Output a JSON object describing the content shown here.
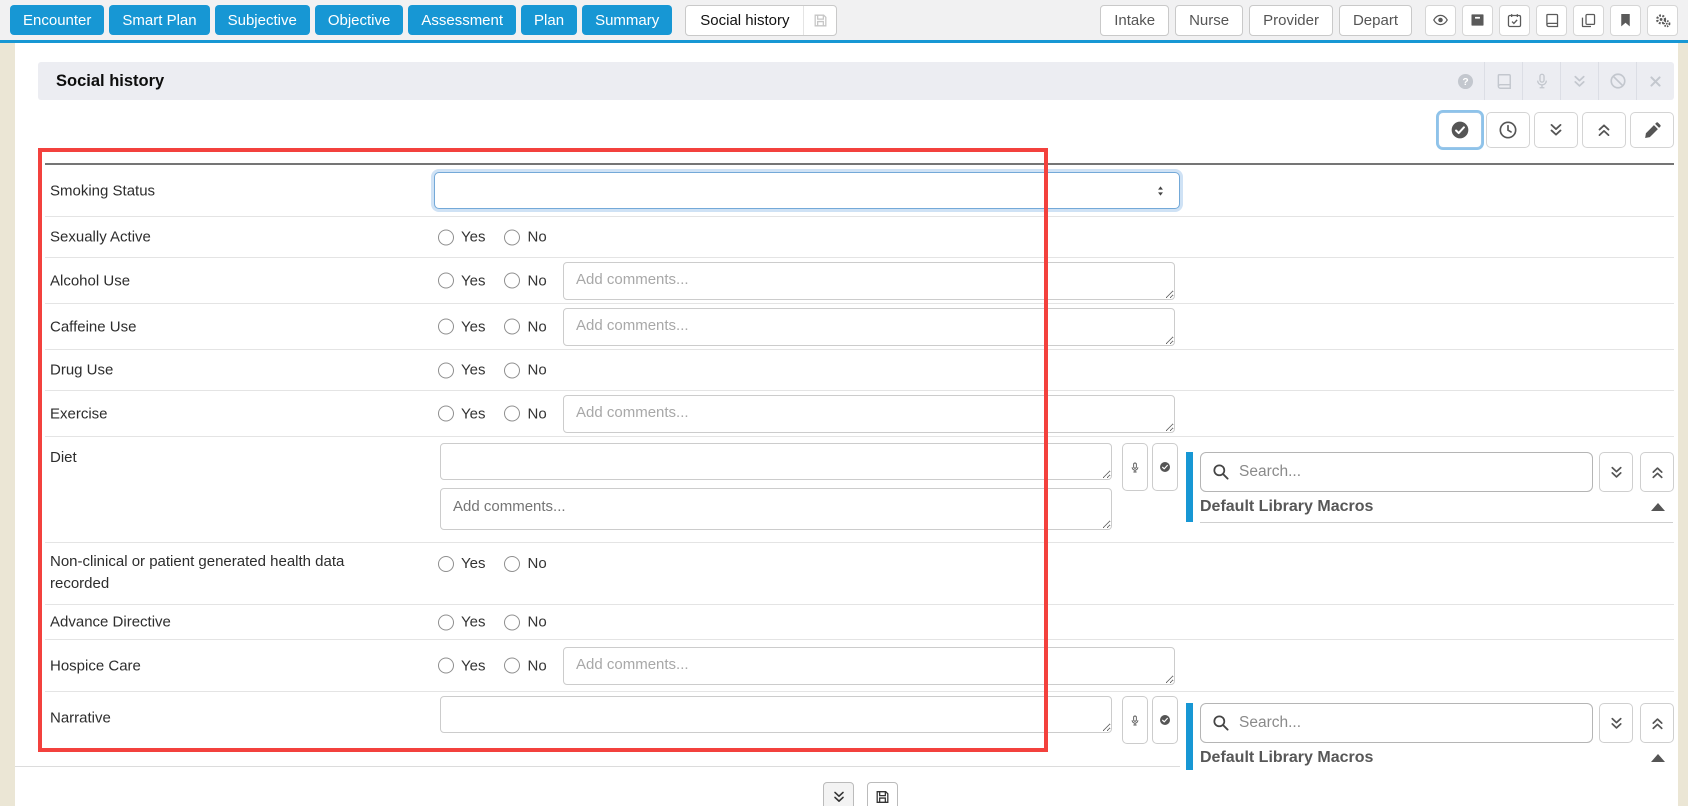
{
  "colors": {
    "accent_blue": "#1797d4",
    "annotation_red": "#f3413d"
  },
  "topbar": {
    "nav_buttons": [
      "Encounter",
      "Smart Plan",
      "Subjective",
      "Objective",
      "Assessment",
      "Plan",
      "Summary"
    ],
    "active_tab_label": "Social history",
    "role_buttons": [
      "Intake",
      "Nurse",
      "Provider",
      "Depart"
    ],
    "icon_buttons": [
      "eye-icon",
      "archive-icon",
      "calendar-check-icon",
      "book-icon",
      "copy-icon",
      "bookmark-icon",
      "gears-icon"
    ]
  },
  "section": {
    "title": "Social history",
    "header_icons": [
      "help-icon",
      "book-icon",
      "mic-icon",
      "double-chevron-down-icon",
      "ban-icon",
      "close-icon"
    ],
    "action_icons": [
      "check-circle-icon",
      "clock-icon",
      "double-chevron-down-icon",
      "double-chevron-up-icon",
      "pencil-icon"
    ]
  },
  "form": {
    "radio_options": [
      "Yes",
      "No"
    ],
    "comment_placeholder": "Add comments...",
    "smoking_select_value": "",
    "diet_value": "",
    "narrative_value": "",
    "rows": [
      {
        "label": "Smoking Status",
        "type": "select"
      },
      {
        "label": "Sexually Active",
        "type": "radio"
      },
      {
        "label": "Alcohol Use",
        "type": "radio-comment"
      },
      {
        "label": "Caffeine Use",
        "type": "radio-comment"
      },
      {
        "label": "Drug Use",
        "type": "radio"
      },
      {
        "label": "Exercise",
        "type": "radio-comment"
      },
      {
        "label": "Diet",
        "type": "text-comment"
      },
      {
        "label": "Non-clinical or patient generated health data recorded",
        "type": "radio"
      },
      {
        "label": "Advance Directive",
        "type": "radio"
      },
      {
        "label": "Hospice Care",
        "type": "radio-comment"
      },
      {
        "label": "Narrative",
        "type": "text"
      }
    ]
  },
  "macros": {
    "search_placeholder": "Search...",
    "title": "Default Library Macros"
  }
}
